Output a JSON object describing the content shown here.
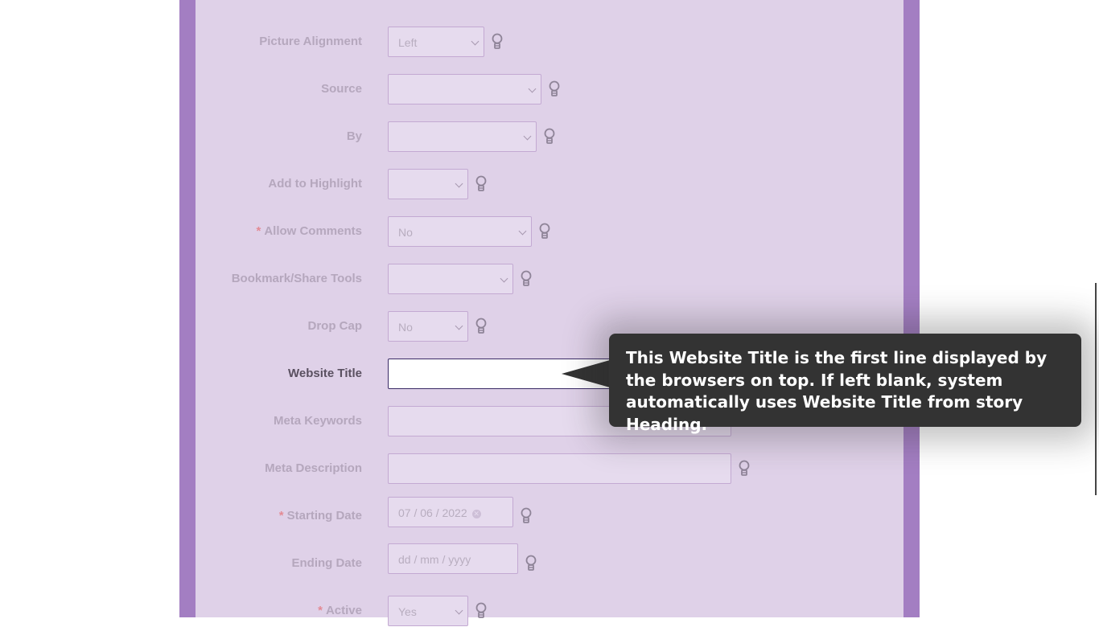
{
  "form": {
    "picture_alignment": {
      "label": "Picture Alignment",
      "value": "Left",
      "required": false
    },
    "source": {
      "label": "Source",
      "value": "",
      "required": false
    },
    "by": {
      "label": "By",
      "value": "",
      "required": false
    },
    "add_to_highlight": {
      "label": "Add to Highlight",
      "value": "",
      "required": false
    },
    "allow_comments": {
      "label": "Allow Comments",
      "value": "No",
      "required": true
    },
    "bookmark_share_tools": {
      "label": "Bookmark/Share Tools",
      "value": "",
      "required": false
    },
    "drop_cap": {
      "label": "Drop Cap",
      "value": "No",
      "required": false
    },
    "website_title": {
      "label": "Website Title",
      "value": "",
      "required": false
    },
    "meta_keywords": {
      "label": "Meta Keywords",
      "value": "",
      "required": false
    },
    "meta_description": {
      "label": "Meta Description",
      "value": "",
      "required": false
    },
    "starting_date": {
      "label": "Starting Date",
      "value": "07 / 06 / 2022",
      "required": true
    },
    "ending_date": {
      "label": "Ending Date",
      "placeholder": "dd / mm / yyyy",
      "required": false
    },
    "active": {
      "label": "Active",
      "value": "Yes",
      "required": true
    },
    "required_marker": "*"
  },
  "tooltip": {
    "text": "This Website Title is the first line displayed by the browsers on top. If left blank, system automatically uses Website Title from story Heading."
  },
  "icons": {
    "help": "lightbulb-icon",
    "dropdown": "chevron-down-icon",
    "clear": "clear-icon"
  },
  "colors": {
    "frame": "#a37ec2",
    "panel": "#dfd1e8",
    "tooltip_bg": "#333333",
    "required_marker": "#e38a94"
  }
}
